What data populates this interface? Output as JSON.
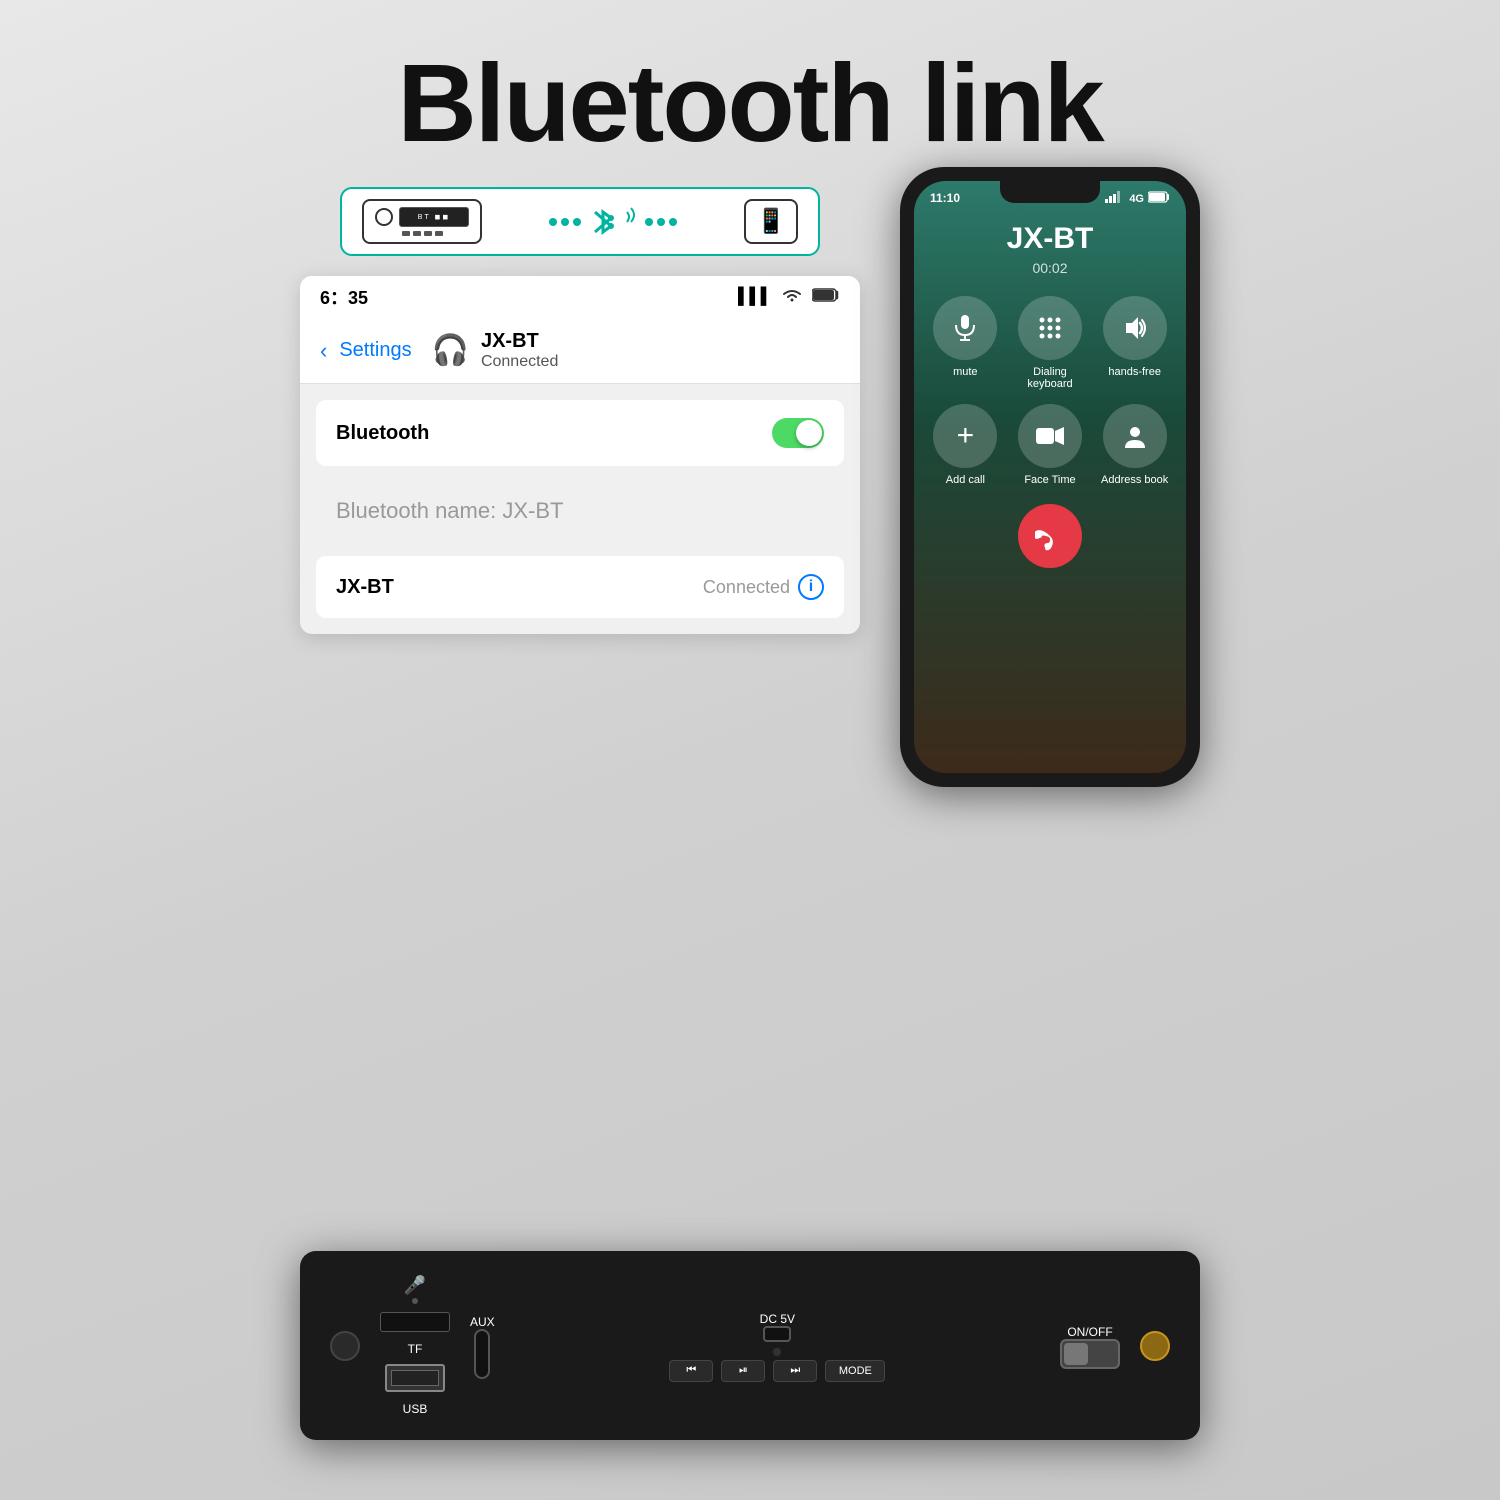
{
  "page": {
    "title": "Bluetooth link",
    "background": "#d8d8d8"
  },
  "connector_diagram": {
    "device_screen_text": "BT",
    "bluetooth_symbol": "✦",
    "arrow_dots": [
      "·",
      "·",
      "·",
      "·",
      "·"
    ]
  },
  "ios_screen": {
    "status_bar": {
      "time": "6：35",
      "signal_icon": "📶",
      "wifi_icon": "📡",
      "battery_icon": "🔋"
    },
    "header": {
      "back_label": "Settings",
      "device_name": "JX-BT",
      "connection_status": "Connected"
    },
    "bluetooth_row": {
      "label": "Bluetooth",
      "toggle_on": true
    },
    "bt_name_row": {
      "label": "Bluetooth name: JX-BT"
    },
    "device_row": {
      "name": "JX-BT",
      "status": "Connected"
    }
  },
  "phone_call": {
    "status_bar": {
      "time": "11:10",
      "signal": "4G",
      "battery": "full"
    },
    "contact_name": "JX-BT",
    "duration": "00:02",
    "buttons": [
      {
        "icon": "🎤",
        "label": "mute"
      },
      {
        "icon": "⌨️",
        "label": "Dialing keyboard"
      },
      {
        "icon": "🔊",
        "label": "hands-free"
      },
      {
        "icon": "+",
        "label": "Add call"
      },
      {
        "icon": "📹",
        "label": "Face Time"
      },
      {
        "icon": "📋",
        "label": "Address book"
      }
    ],
    "end_call_icon": "📞"
  },
  "hardware_board": {
    "labels": {
      "tf": "TF",
      "aux": "AUX",
      "dc5v": "DC 5V",
      "onoff": "ON/OFF",
      "usb": "USB",
      "mode": "MODE"
    },
    "buttons": [
      {
        "symbol": "⏮",
        "label": "prev"
      },
      {
        "symbol": "⏯",
        "label": "play"
      },
      {
        "symbol": "⏭",
        "label": "next"
      }
    ]
  }
}
